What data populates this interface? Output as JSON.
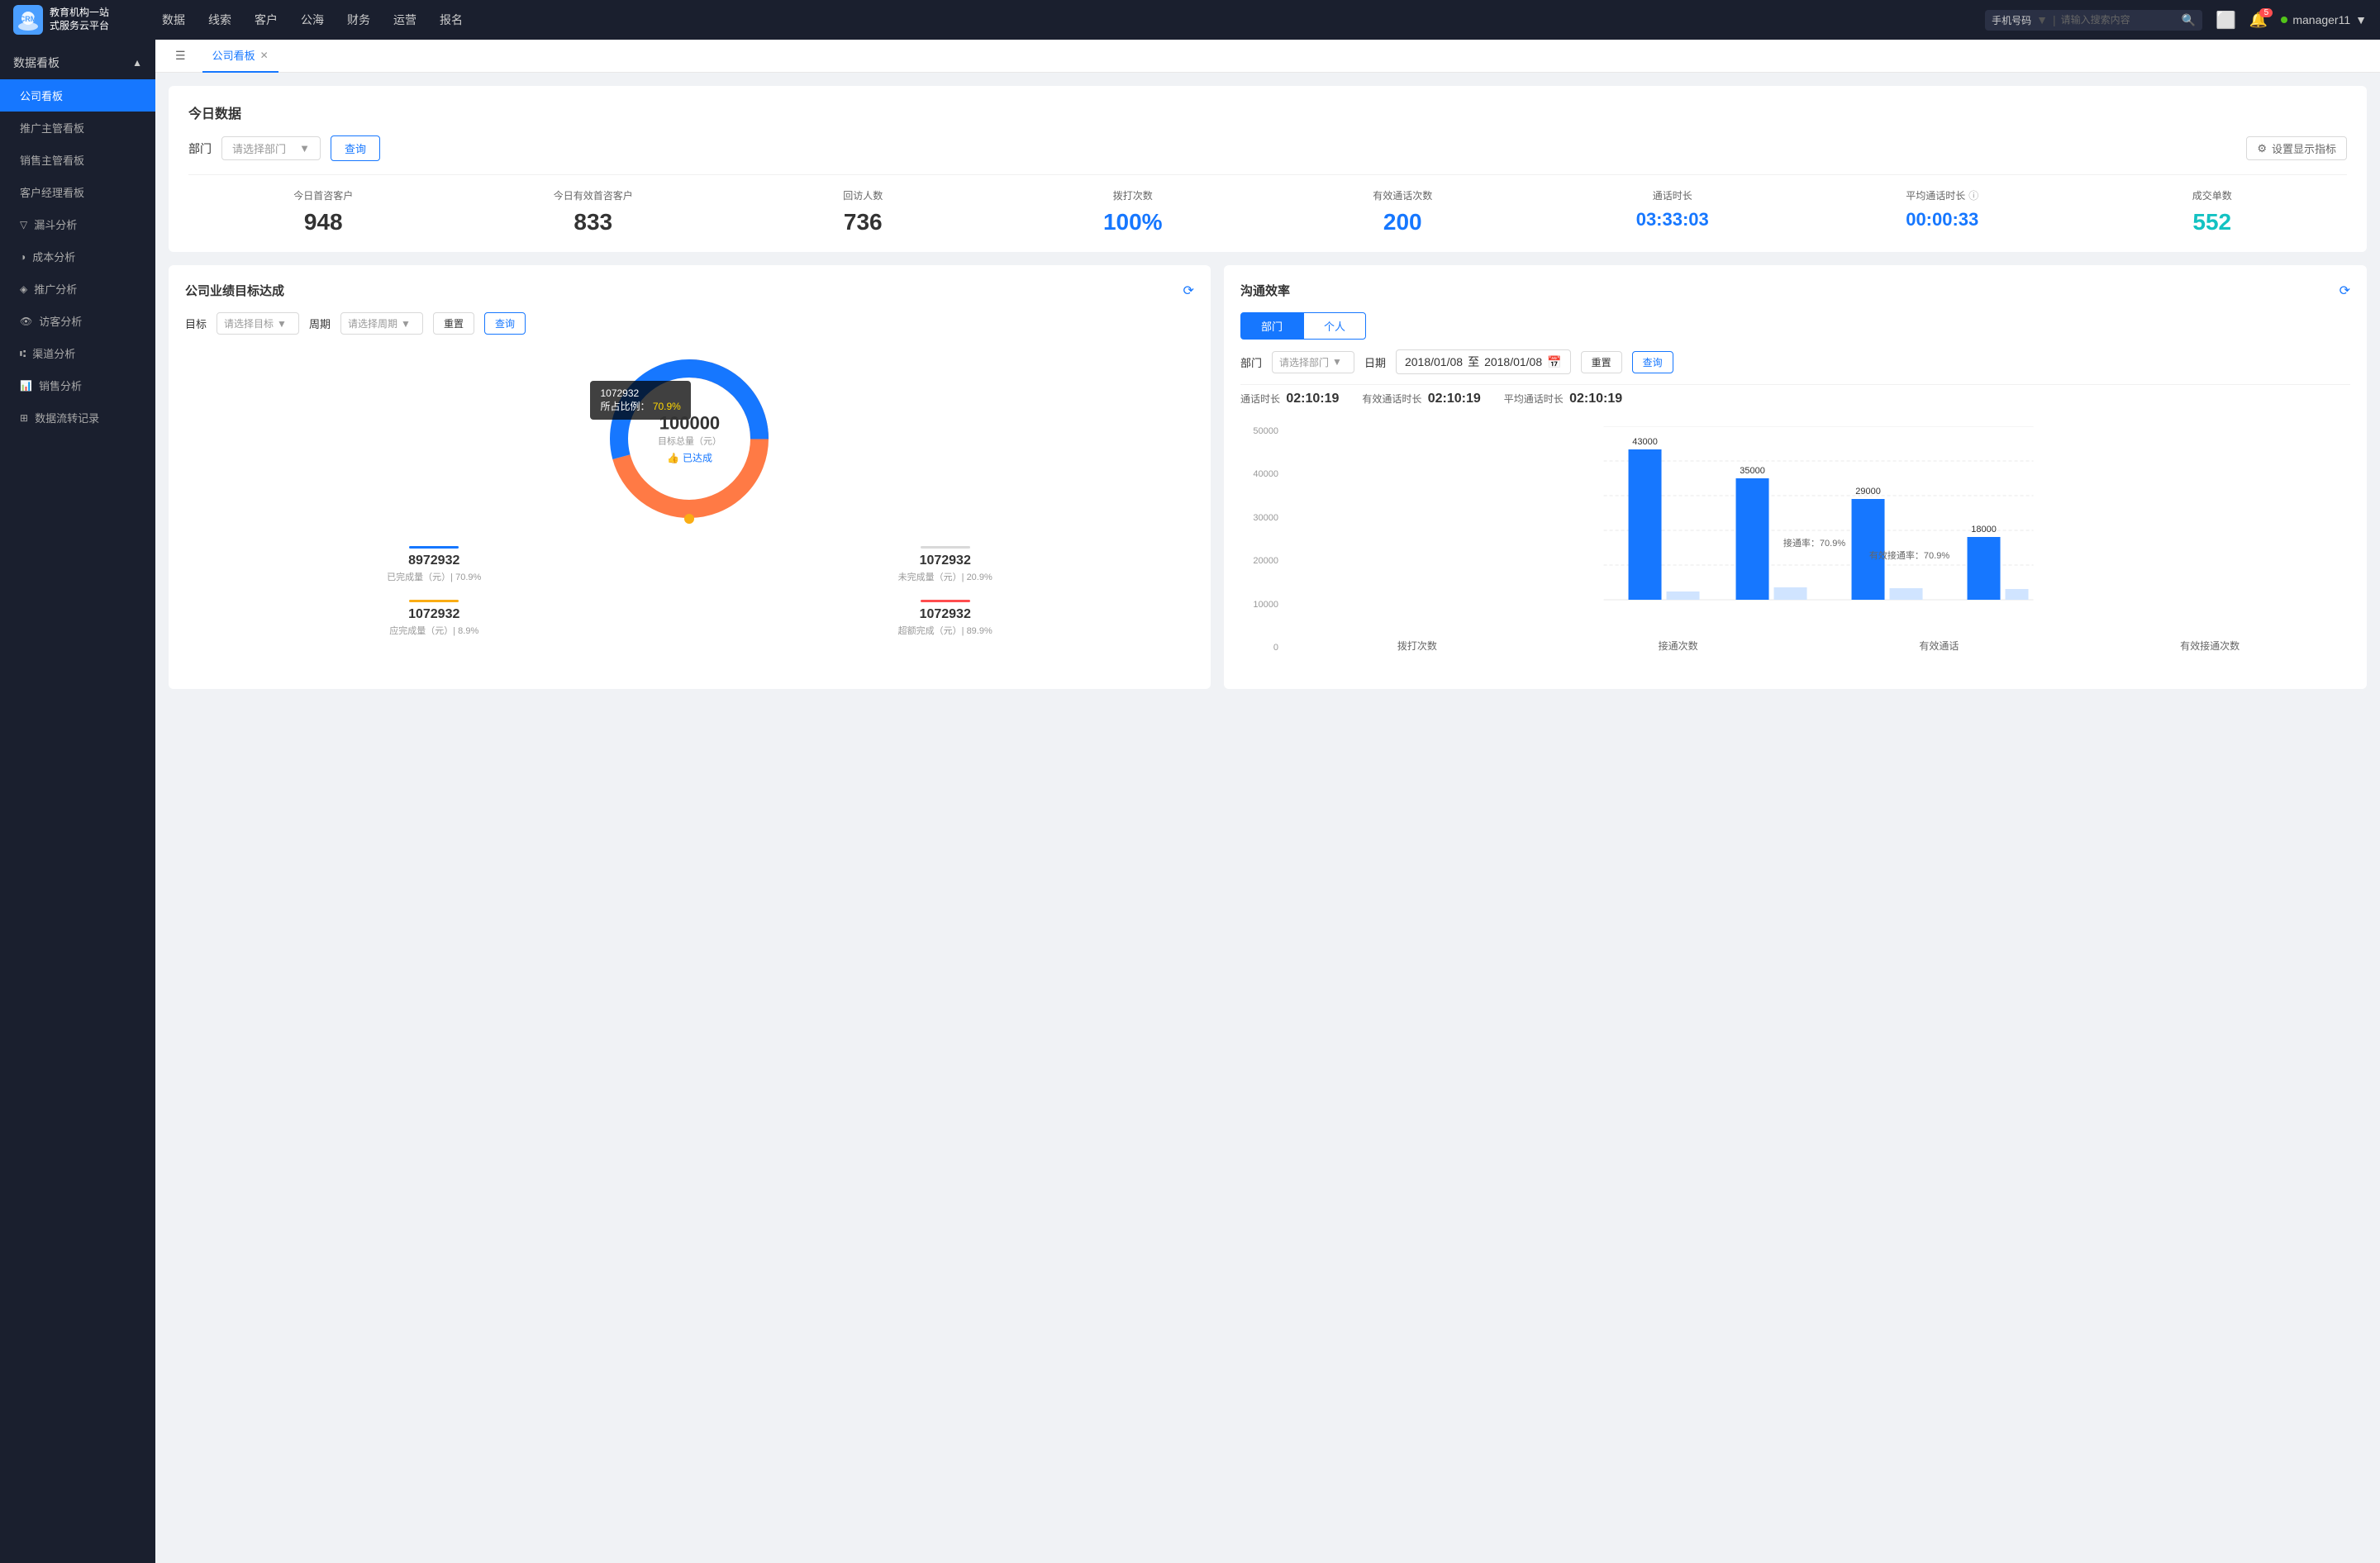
{
  "topNav": {
    "logo": {
      "iconText": "云朵",
      "line1": "教育机构一站",
      "line2": "式服务云平台"
    },
    "links": [
      "数据",
      "线索",
      "客户",
      "公海",
      "财务",
      "运营",
      "报名"
    ],
    "search": {
      "selectLabel": "手机号码",
      "placeholder": "请输入搜索内容"
    },
    "notificationCount": "5",
    "username": "manager11"
  },
  "sidebar": {
    "sectionTitle": "数据看板",
    "items": [
      {
        "label": "公司看板",
        "active": true
      },
      {
        "label": "推广主管看板",
        "active": false
      },
      {
        "label": "销售主管看板",
        "active": false
      },
      {
        "label": "客户经理看板",
        "active": false
      },
      {
        "label": "漏斗分析",
        "active": false
      },
      {
        "label": "成本分析",
        "active": false
      },
      {
        "label": "推广分析",
        "active": false
      },
      {
        "label": "访客分析",
        "active": false
      },
      {
        "label": "渠道分析",
        "active": false
      },
      {
        "label": "销售分析",
        "active": false
      },
      {
        "label": "数据流转记录",
        "active": false
      }
    ]
  },
  "tabs": [
    {
      "label": "公司看板",
      "active": true,
      "closable": true
    }
  ],
  "todayData": {
    "sectionTitle": "今日数据",
    "deptLabel": "部门",
    "deptPlaceholder": "请选择部门",
    "queryBtn": "查询",
    "settingsBtn": "设置显示指标",
    "metrics": [
      {
        "label": "今日首咨客户",
        "value": "948",
        "colorClass": "black"
      },
      {
        "label": "今日有效首咨客户",
        "value": "833",
        "colorClass": "black"
      },
      {
        "label": "回访人数",
        "value": "736",
        "colorClass": "black"
      },
      {
        "label": "拨打次数",
        "value": "100%",
        "colorClass": "blue"
      },
      {
        "label": "有效通话次数",
        "value": "200",
        "colorClass": "blue"
      },
      {
        "label": "通话时长",
        "value": "03:33:03",
        "colorClass": "blue"
      },
      {
        "label": "平均通话时长",
        "value": "00:00:33",
        "colorClass": "blue"
      },
      {
        "label": "成交单数",
        "value": "552",
        "colorClass": "cyan"
      }
    ]
  },
  "targetPanel": {
    "title": "公司业绩目标达成",
    "targetLabel": "目标",
    "targetPlaceholder": "请选择目标",
    "periodLabel": "周期",
    "periodPlaceholder": "请选择周期",
    "resetBtn": "重置",
    "queryBtn": "查询",
    "donut": {
      "tooltip": {
        "value": "1072932",
        "ratioLabel": "所占比例：",
        "ratio": "70.9%"
      },
      "centerValue": "100000",
      "centerLabel": "目标总量（元）",
      "achievedLabel": "已达成"
    },
    "stats": [
      {
        "label": "已完成量（元）| 70.9%",
        "value": "8972932",
        "color": "#1677ff"
      },
      {
        "label": "未完成量（元）| 20.9%",
        "value": "1072932",
        "color": "#d9d9d9"
      },
      {
        "label": "应完成量（元）| 8.9%",
        "value": "1072932",
        "color": "#faad14"
      },
      {
        "label": "超额完成（元）| 89.9%",
        "value": "1072932",
        "color": "#ff4d4f"
      }
    ]
  },
  "efficiencyPanel": {
    "title": "沟通效率",
    "tabDept": "部门",
    "tabPerson": "个人",
    "activeDeptTab": true,
    "deptLabel": "部门",
    "deptPlaceholder": "请选择部门",
    "dateLabel": "日期",
    "dateFrom": "2018/01/08",
    "dateTo": "2018/01/08",
    "resetBtn": "重置",
    "queryBtn": "查询",
    "statsRow": {
      "callDurationLabel": "通话时长",
      "callDurationValue": "02:10:19",
      "effectiveLabel": "有效通话时长",
      "effectiveValue": "02:10:19",
      "avgLabel": "平均通话时长",
      "avgValue": "02:10:19"
    },
    "chart": {
      "yAxis": [
        "50000",
        "40000",
        "30000",
        "20000",
        "10000",
        "0"
      ],
      "groups": [
        {
          "label": "拨打次数",
          "bars": [
            {
              "value": 43000,
              "label": "43000",
              "color": "#1677ff",
              "height": 86
            },
            {
              "value": 0,
              "label": "",
              "color": "#d0e4ff",
              "height": 4
            }
          ]
        },
        {
          "label": "接通次数",
          "bars": [
            {
              "value": 35000,
              "label": "35000",
              "color": "#1677ff",
              "height": 70
            },
            {
              "value": 0,
              "label": "接通率：70.9%",
              "color": "#d0e4ff",
              "height": 4
            }
          ],
          "rateLabel": "接通率：70.9%"
        },
        {
          "label": "有效通话",
          "bars": [
            {
              "value": 29000,
              "label": "29000",
              "color": "#1677ff",
              "height": 58
            },
            {
              "value": 0,
              "label": "",
              "color": "#d0e4ff",
              "height": 4
            }
          ],
          "rateLabel": "有效接通率：70.9%"
        },
        {
          "label": "有效接通次数",
          "bars": [
            {
              "value": 18000,
              "label": "18000",
              "color": "#1677ff",
              "height": 36
            },
            {
              "value": 0,
              "label": "",
              "color": "#d0e4ff",
              "height": 4
            }
          ]
        }
      ]
    }
  }
}
